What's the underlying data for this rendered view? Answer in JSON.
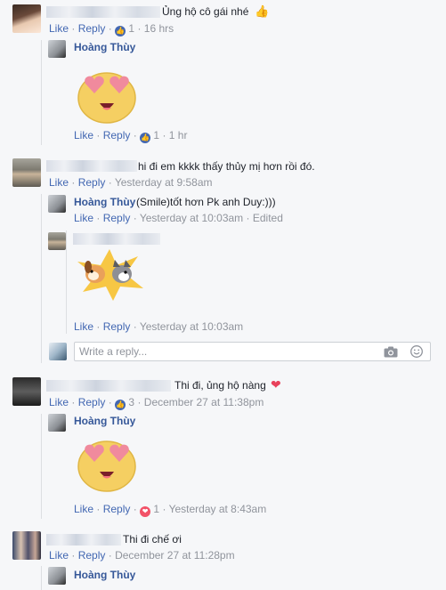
{
  "actions": {
    "like": "Like",
    "reply": "Reply",
    "dot": "·",
    "edited": "Edited"
  },
  "comments": [
    {
      "text": "Ủng hộ cô gái nhé",
      "emoji": "👍",
      "reaction_count": "1",
      "time": "16 hrs",
      "reply": {
        "author": "Hoàng Thùy",
        "reaction_count": "1",
        "time": "1 hr"
      }
    },
    {
      "text": "hi đi em kkkk thấy thủy mị hơn rồi đó.",
      "time": "Yesterday at 9:58am",
      "replies": [
        {
          "author": "Hoàng Thùy",
          "text": "(Smile)tốt hơn Pk anh Duy:)))",
          "time": "Yesterday at 10:03am"
        },
        {
          "time": "Yesterday at 10:03am"
        }
      ],
      "write_reply_placeholder": "Write a reply..."
    },
    {
      "text": "Thi đi, ủng hộ nàng",
      "emoji": "❤",
      "reaction_count": "3",
      "time": "December 27 at 11:38pm",
      "reply": {
        "author": "Hoàng Thùy",
        "reaction_count": "1",
        "time": "Yesterday at 8:43am"
      }
    },
    {
      "text": "Thi đi chế ơi",
      "time": "December 27 at 11:28pm",
      "reply": {
        "author": "Hoàng Thùy"
      }
    }
  ],
  "icons": {
    "like": "like-thumb-icon",
    "love": "love-heart-icon",
    "camera": "camera-icon",
    "smiley": "smiley-icon"
  },
  "colors": {
    "link": "#4267b2",
    "name": "#365899",
    "meta": "#90949c",
    "love": "#f25268"
  }
}
